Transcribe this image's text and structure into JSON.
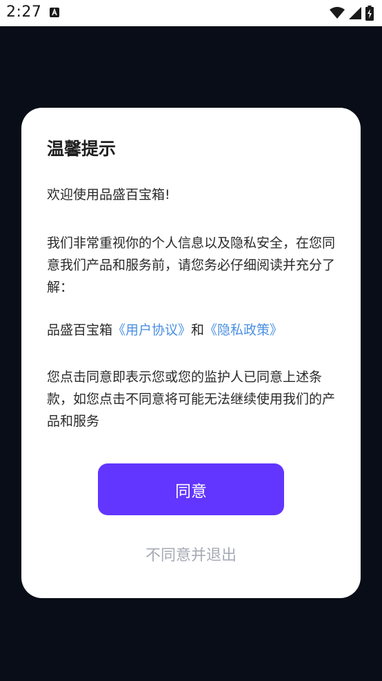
{
  "status_bar": {
    "time": "2:27",
    "icons": [
      "keyboard-a-icon",
      "wifi-icon",
      "cellular-signal-icon",
      "battery-charging-icon"
    ]
  },
  "dialog": {
    "title": "温馨提示",
    "welcome": "欢迎使用品盛百宝箱!",
    "intro": "我们非常重视你的个人信息以及隐私安全，在您同意我们产品和服务前，请您务必仔细阅读并充分了解：",
    "links_prefix": "品盛百宝箱",
    "user_agreement_link": "《用户协议》",
    "links_and": "和",
    "privacy_policy_link": "《隐私政策》",
    "consent": "您点击同意即表示您或您的监护人已同意上述条款，如您点击不同意将可能无法继续使用我们的产品和服务",
    "agree_label": "同意",
    "disagree_label": "不同意并退出"
  },
  "colors": {
    "background": "#080d17",
    "accent": "#6236ff",
    "link": "#4a90e2",
    "muted": "#a6aab4"
  }
}
